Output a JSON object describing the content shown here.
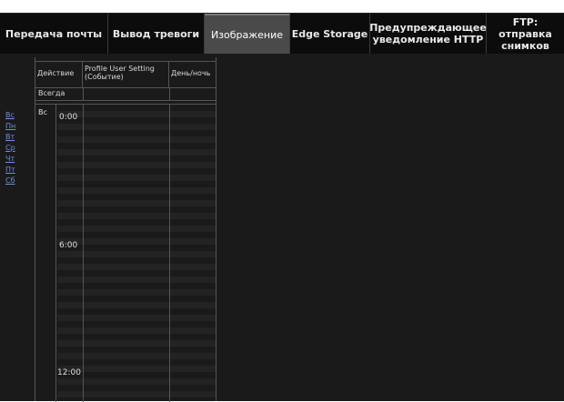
{
  "tabs": [
    {
      "label": "Передача почты"
    },
    {
      "label": "Вывод тревоги"
    },
    {
      "label": "Изображение"
    },
    {
      "label": "Edge Storage"
    },
    {
      "label": "Предупреждающее уведомление HTTP"
    },
    {
      "label": "FTP: отправка снимков"
    }
  ],
  "days": [
    "Вс",
    "Пн",
    "Вт",
    "Ср",
    "Чт",
    "Пт",
    "Сб"
  ],
  "table": {
    "col_action": "Действие",
    "col_profile": "Profile User Setting (Событие)",
    "col_daynight": "День/ночь",
    "always_label": "Всегда",
    "current_day": "Вс",
    "times": [
      "0:00",
      "6:00",
      "12:00"
    ]
  }
}
